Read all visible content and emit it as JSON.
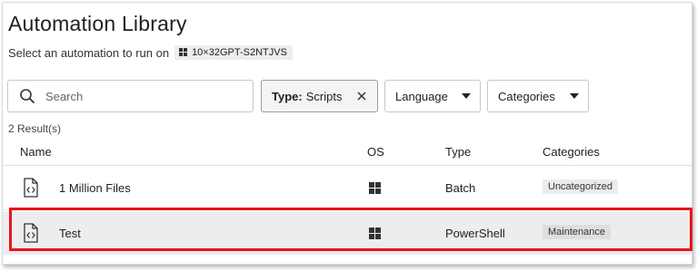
{
  "header": {
    "title": "Automation Library",
    "subtitle": "Select an automation to run on",
    "device_name": "10×32GPT-S2NTJVS"
  },
  "filters": {
    "search_placeholder": "Search",
    "type_label": "Type:",
    "type_value": "Scripts",
    "language_label": "Language",
    "categories_label": "Categories"
  },
  "results_count": "2 Result(s)",
  "table": {
    "columns": [
      "Name",
      "OS",
      "Type",
      "Categories"
    ],
    "rows": [
      {
        "name": "1 Million Files",
        "os": "windows-icon",
        "type": "Batch",
        "category": "Uncategorized"
      },
      {
        "name": "Test",
        "os": "windows-icon",
        "type": "PowerShell",
        "category": "Maintenance"
      }
    ]
  },
  "colors": {
    "highlight": "#e8141b",
    "selected_row": "#ededed"
  }
}
